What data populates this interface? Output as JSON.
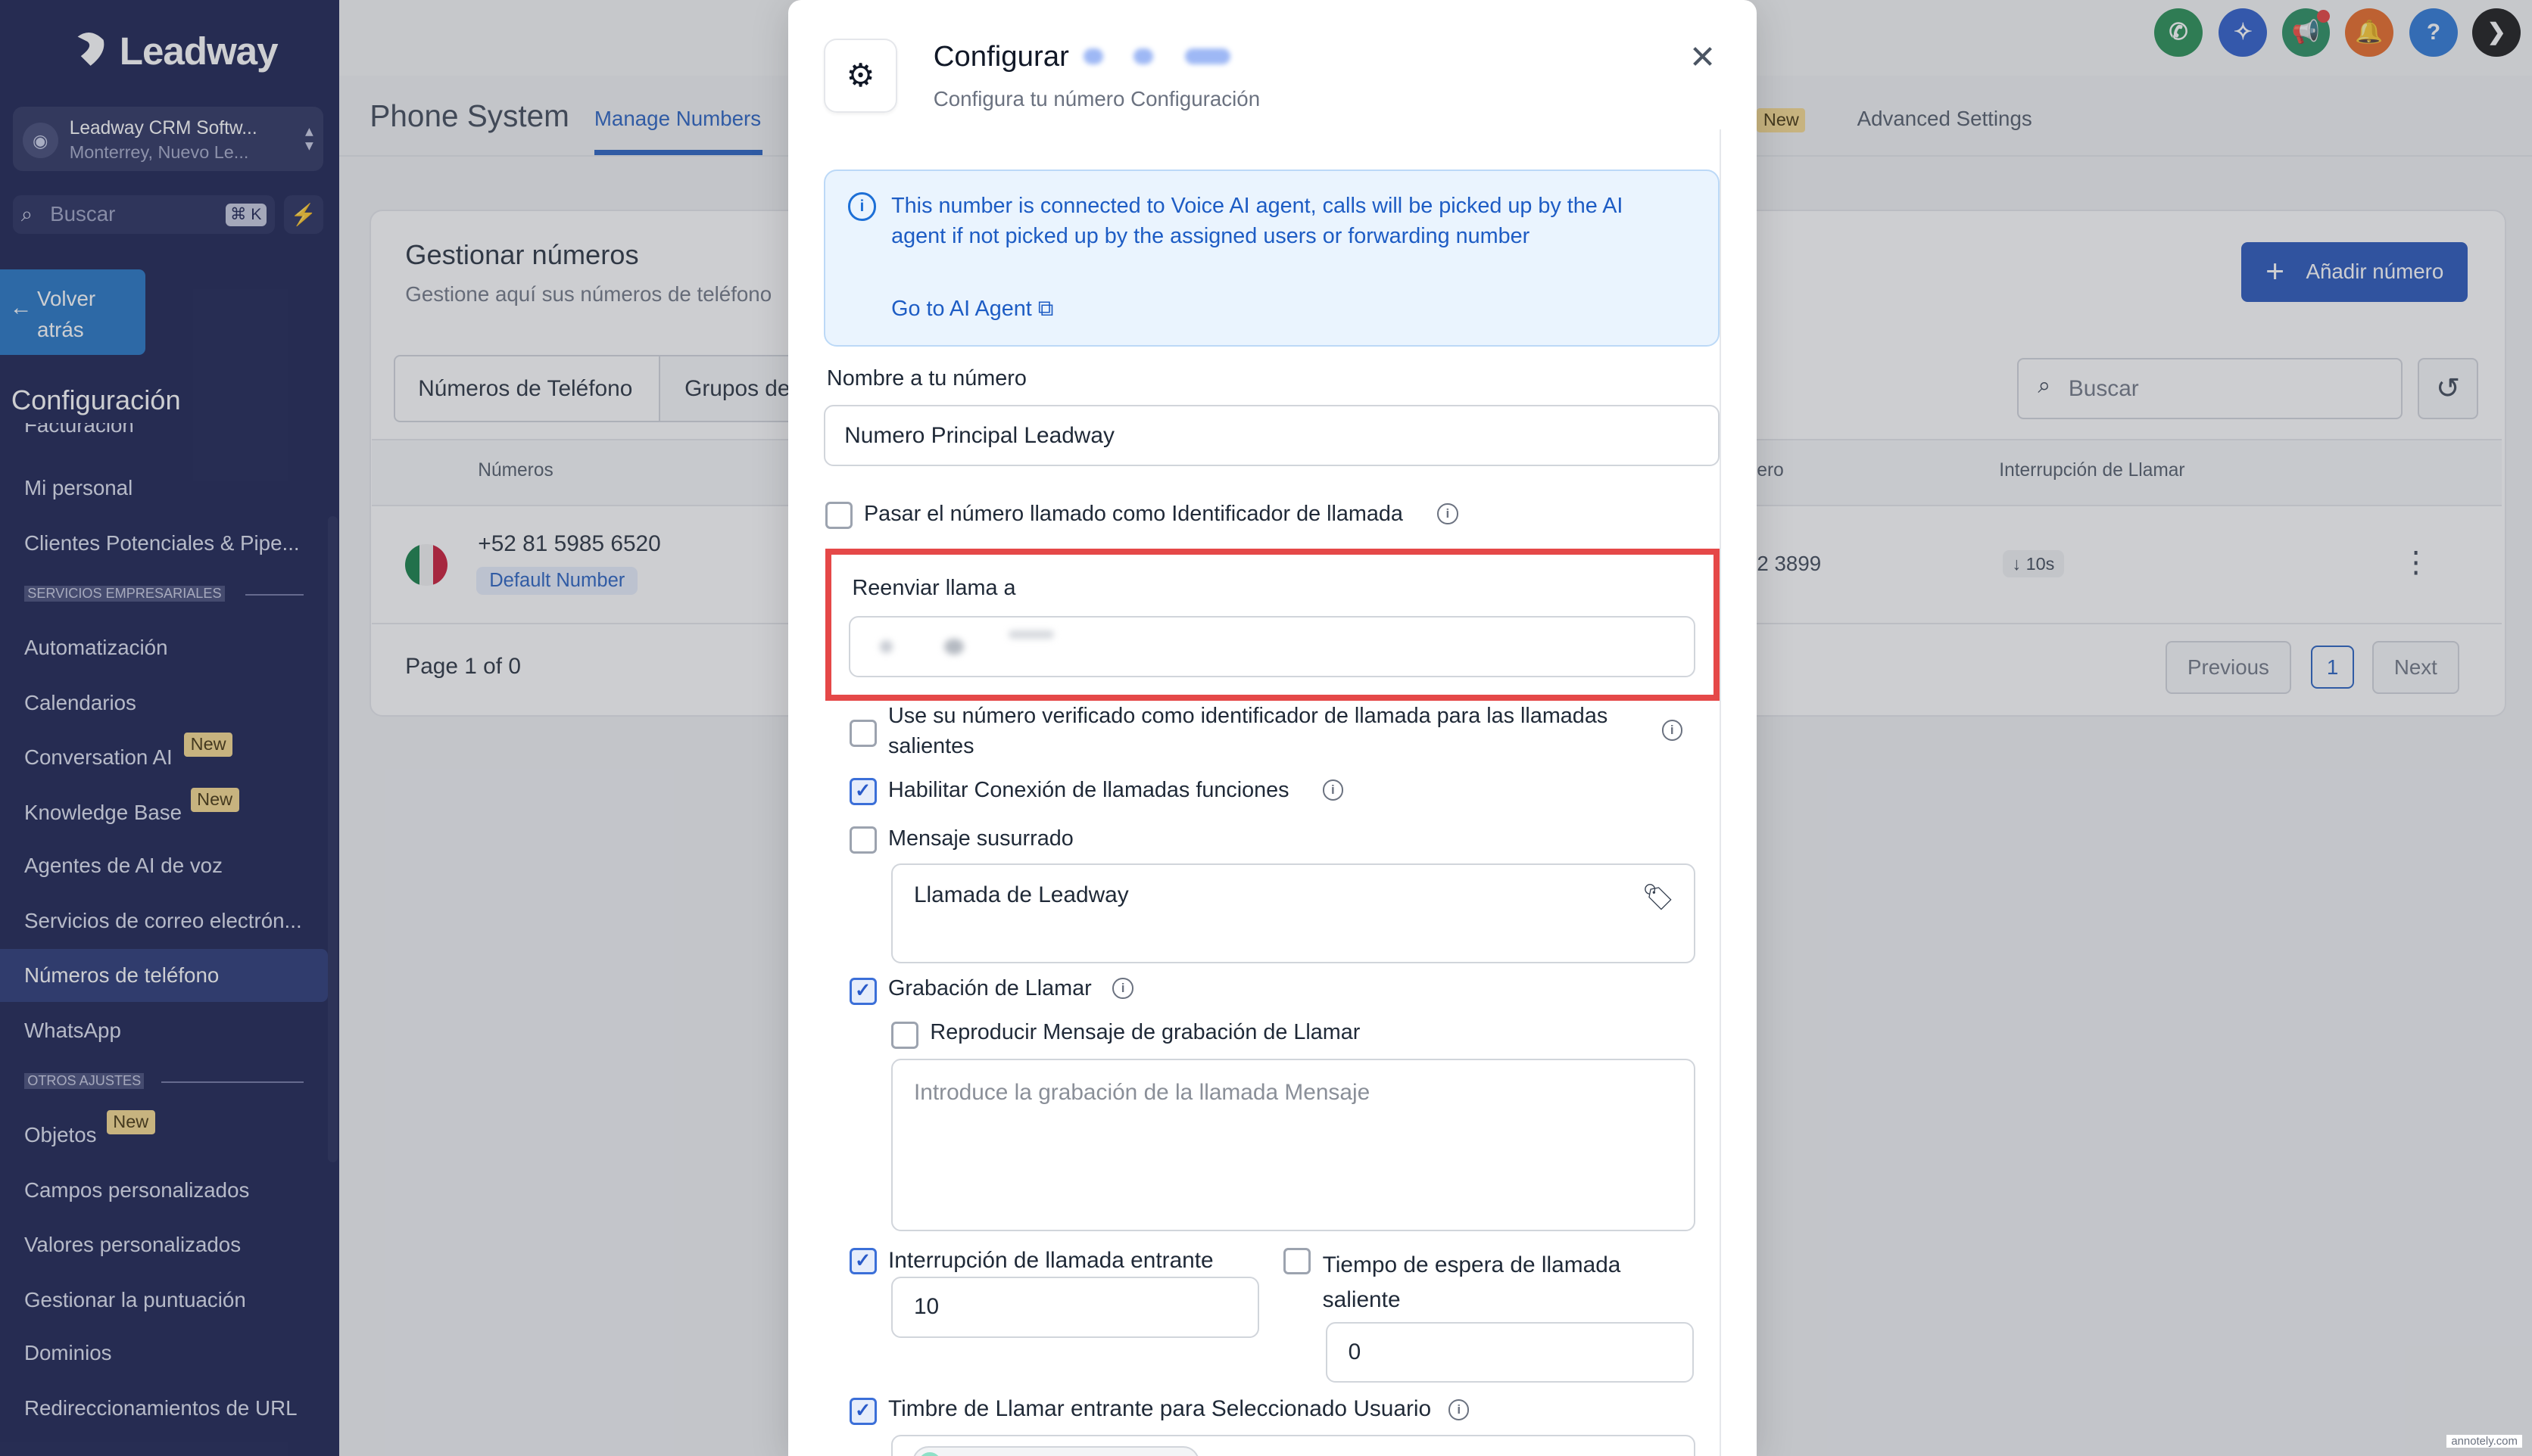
{
  "sidebar": {
    "logo": "Leadway",
    "account_name": "Leadway CRM Softw...",
    "account_location": "Monterrey, Nuevo Le...",
    "search_placeholder": "Buscar",
    "search_shortcut": "⌘ K",
    "back_label": "Volver atrás",
    "heading": "Configuración",
    "clipped_item": "Facturación",
    "items_a": [
      "Mi personal",
      "Clientes Potenciales & Pipe..."
    ],
    "section_business": "SERVICIOS EMPRESARIALES",
    "items_b": [
      "Automatización",
      "Calendarios",
      "Conversation AI",
      "Knowledge Base",
      "Agentes de AI de voz",
      "Servicios de correo electrón...",
      "Números de teléfono",
      "WhatsApp"
    ],
    "section_other": "OTROS AJUSTES",
    "items_c": [
      "Objetos",
      "Campos personalizados",
      "Valores personalizados",
      "Gestionar la puntuación",
      "Dominios",
      "Redireccionamientos de URL"
    ],
    "new_badge": "New"
  },
  "page": {
    "title": "Phone System",
    "tabs": [
      "Manage Numbers",
      "Advanced Settings"
    ],
    "tab_new_badge": "New",
    "card_title": "Gestionar números",
    "card_subtitle": "Gestione aquí sus números de teléfono",
    "add_button": "Añadir número",
    "seg_tabs": [
      "Números de Teléfono",
      "Grupos de"
    ],
    "search_placeholder": "Buscar",
    "col_numbers": "Números",
    "col_number_partial": "ero",
    "col_interrupt": "Interrupción de Llamar",
    "row_number": "+52 81 5985 6520",
    "row_badge": "Default Number",
    "row_partial_number": "2 3899",
    "row_timeout": "10s",
    "pagination_text": "Page 1 of 0",
    "prev": "Previous",
    "page_num": "1",
    "next": "Next"
  },
  "modal": {
    "title": "Configurar",
    "subtitle": "Configura tu número Configuración",
    "info_text": "This number is connected to Voice AI agent, calls will be picked up by the AI agent if not picked up by the assigned users or forwarding number",
    "info_link": "Go to AI Agent",
    "name_label": "Nombre a tu número",
    "name_value": "Numero Principal Leadway",
    "pass_caller_id": "Pasar el número llamado como Identificador de llamada",
    "forward_label": "Reenviar llama a",
    "verified_caller": "Use su número verificado como identificador de llamada para las llamadas salientes",
    "enable_connect": "Habilitar Conexión de llamadas funciones",
    "whisper": "Mensaje susurrado",
    "whisper_value": "Llamada de Leadway",
    "recording": "Grabación de Llamar",
    "play_recording_msg": "Reproducir Mensaje de grabación de Llamar",
    "recording_placeholder": "Introduce la grabación de la llamada Mensaje",
    "inbound_timeout": "Interrupción de llamada entrante",
    "inbound_timeout_value": "10",
    "outbound_timeout": "Tiempo de espera de llamada saliente",
    "outbound_timeout_value": "0",
    "ring_selected": "Timbre de Llamar entrante para Seleccionado Usuario"
  },
  "header_icons": [
    "phone-icon",
    "sparkle-icon",
    "megaphone-icon",
    "bell-icon",
    "help-icon",
    "profile-icon"
  ],
  "colors": {
    "sidebar": "#11184a",
    "primary": "#1f4fb8",
    "highlight": "#e54848"
  },
  "annotation": "annotely.com"
}
